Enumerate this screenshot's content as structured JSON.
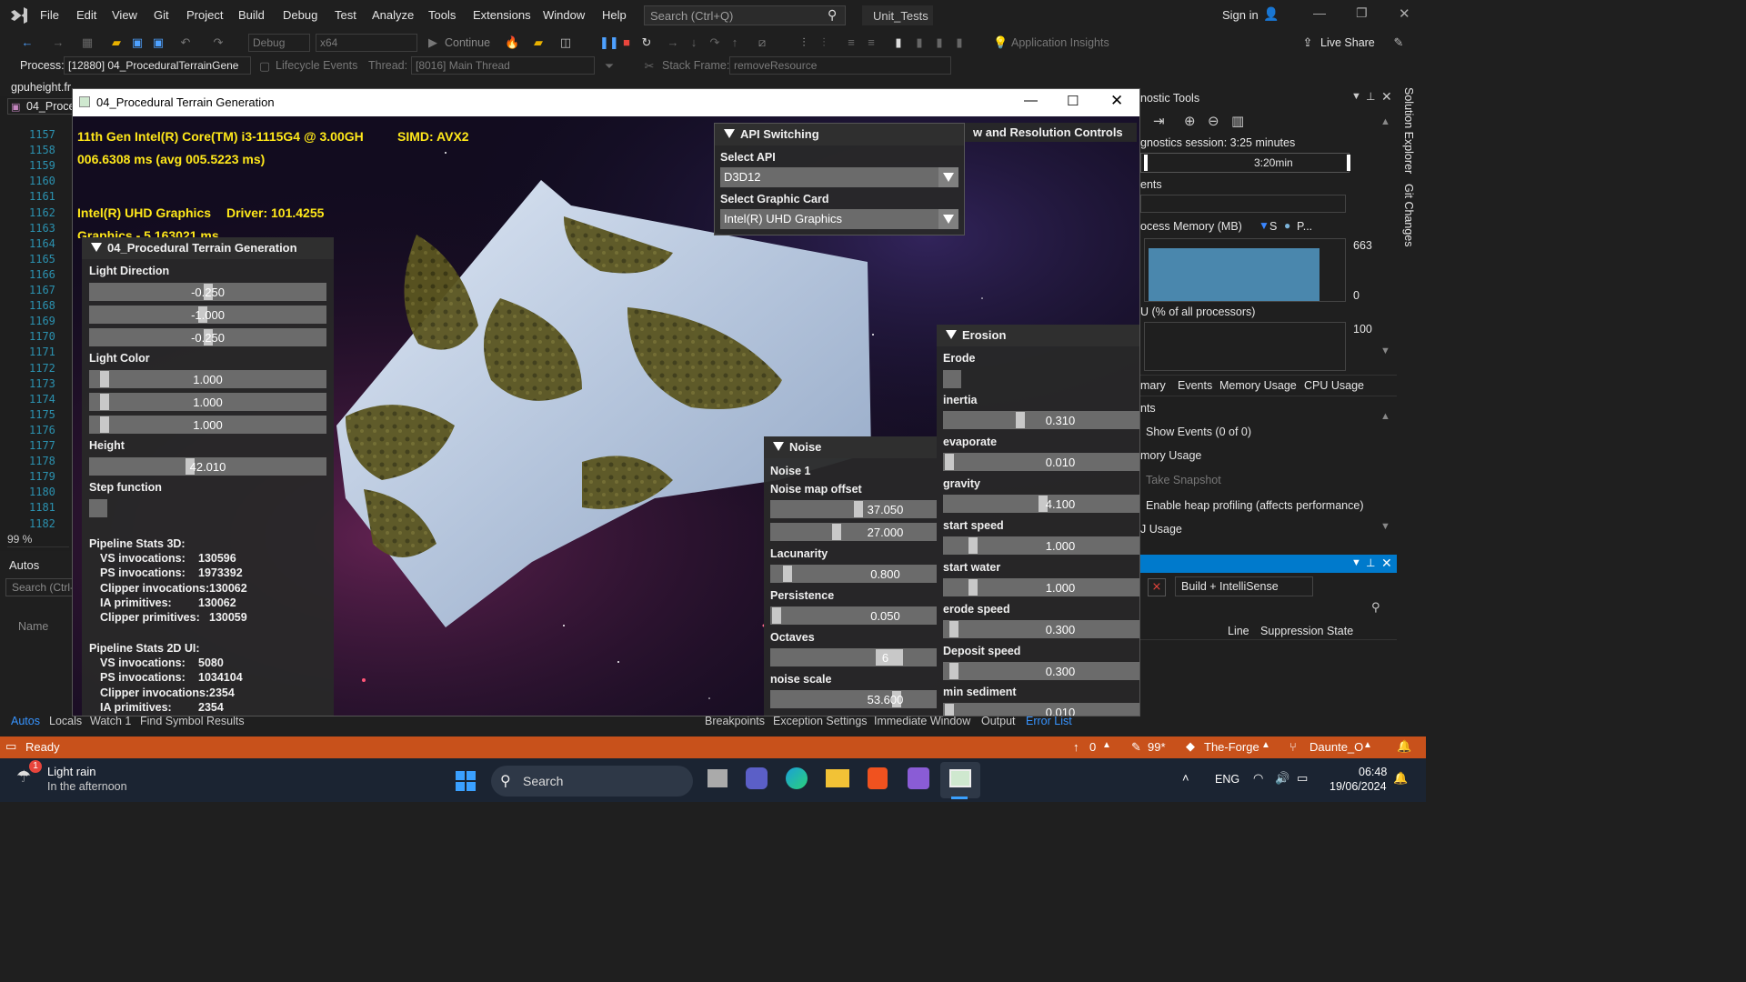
{
  "vs": {
    "menu": [
      "File",
      "Edit",
      "View",
      "Git",
      "Project",
      "Build",
      "Debug",
      "Test",
      "Analyze",
      "Tools",
      "Extensions",
      "Window",
      "Help"
    ],
    "search_placeholder": "Search (Ctrl+Q)",
    "solution_name": "Unit_Tests",
    "sign_in": "Sign in",
    "toolbar": {
      "config": "Debug",
      "platform": "x64",
      "continue": "Continue",
      "app_insights": "Application Insights",
      "live_share": "Live Share"
    },
    "debug_bar": {
      "process_label": "Process:",
      "process_value": "[12880] 04_ProceduralTerrainGene",
      "lifecycle": "Lifecycle Events",
      "thread_label": "Thread:",
      "thread_value": "[8016] Main Thread",
      "stack_label": "Stack Frame:",
      "stack_value": "removeResource"
    },
    "editor": {
      "file_tab": "gpuheight.fr",
      "nav_label": "04_Proce",
      "line_numbers": [
        "1157",
        "1158",
        "1159",
        "1160",
        "1161",
        "1162",
        "1163",
        "1164",
        "1165",
        "1166",
        "1167",
        "1168",
        "1169",
        "1170",
        "1171",
        "1172",
        "1173",
        "1174",
        "1175",
        "1176",
        "1177",
        "1178",
        "1179",
        "1180",
        "1181",
        "1182"
      ],
      "zoom": "99 %"
    },
    "autos": {
      "title": "Autos",
      "search": "Search (Ctrl-",
      "col_name": "Name"
    },
    "bottom_tabs_left": [
      "Autos",
      "Locals",
      "Watch 1",
      "Find Symbol Results"
    ],
    "bottom_tabs_right": [
      "Breakpoints",
      "Exception Settings",
      "Immediate Window",
      "Output",
      "Error List"
    ],
    "status": {
      "ready": "Ready",
      "up_count": "0",
      "edits": "99*",
      "repo": "The-Forge",
      "branch": "Daunte_O"
    },
    "diagnostics": {
      "title": "nostic Tools",
      "session": "gnostics session: 3:25 minutes",
      "time_marker": "3:20min",
      "events": "ents",
      "process_memory": "ocess Memory (MB)",
      "legend_s": "S",
      "legend_p": "P...",
      "mem_max": "663",
      "mem_min": "0",
      "cpu_title": "U (% of all processors)",
      "cpu_max": "100",
      "tabs": [
        "mary",
        "Events",
        "Memory Usage",
        "CPU Usage"
      ],
      "sections": [
        "nts",
        "Show Events (0 of 0)",
        "mory Usage",
        "Take Snapshot",
        "Enable heap profiling (affects performance)",
        "J Usage"
      ]
    },
    "errlist": {
      "filter": "Build + IntelliSense",
      "col_line": "Line",
      "col_supp": "Suppression State"
    },
    "right_strip": [
      "Solution Explorer",
      "Git Changes"
    ]
  },
  "app": {
    "title": "04_Procedural Terrain Generation",
    "hud": {
      "cpu": "11th Gen Intel(R) Core(TM) i3-1115G4 @ 3.00GH",
      "simd": "SIMD: AVX2",
      "frame_time": "006.6308 ms (avg 005.5223 ms)",
      "gpu": "Intel(R) UHD Graphics",
      "driver": "Driver: 101.4255",
      "graphics": "Graphics - 5.163021 ms"
    },
    "terrain_panel": {
      "title": "04_Procedural Terrain Generation",
      "light_direction_label": "Light Direction",
      "light_direction": [
        "-0.250",
        "-1.000",
        "-0.250"
      ],
      "light_color_label": "Light Color",
      "light_color": [
        "1.000",
        "1.000",
        "1.000"
      ],
      "height_label": "Height",
      "height": "42.010",
      "step_label": "Step function",
      "stats3d_title": "Pipeline Stats 3D:",
      "stats3d": [
        [
          "VS invocations:",
          "130596"
        ],
        [
          "PS invocations:",
          "1973392"
        ],
        [
          "Clipper invocations:",
          "130062"
        ],
        [
          "IA primitives:",
          "130062"
        ],
        [
          "Clipper primitives:",
          "130059"
        ]
      ],
      "stats2d_title": "Pipeline Stats 2D UI:",
      "stats2d": [
        [
          "VS invocations:",
          "5080"
        ],
        [
          "PS invocations:",
          "1034104"
        ],
        [
          "Clipper invocations:",
          "2354"
        ],
        [
          "IA primitives:",
          "2354"
        ]
      ]
    },
    "api_panel": {
      "title": "API Switching",
      "select_api_label": "Select API",
      "api": "D3D12",
      "select_card_label": "Select Graphic Card",
      "card": "Intel(R) UHD Graphics"
    },
    "vr_panel": {
      "title": "w and Resolution Controls"
    },
    "noise_panel": {
      "title": "Noise",
      "noise1": "Noise 1",
      "offset_label": "Noise map offset",
      "offset": [
        "37.050",
        "27.000"
      ],
      "lacunarity_label": "Lacunarity",
      "lacunarity": "0.800",
      "persistence_label": "Persistence",
      "persistence": "0.050",
      "octaves_label": "Octaves",
      "octaves": "6",
      "scale_label": "noise scale",
      "scale": "53.600"
    },
    "erosion_panel": {
      "title": "Erosion",
      "erode_label": "Erode",
      "inertia_label": "inertia",
      "inertia": "0.310",
      "evaporate_label": "evaporate",
      "evaporate": "0.010",
      "gravity_label": "gravity",
      "gravity": "4.100",
      "start_speed_label": "start speed",
      "start_speed": "1.000",
      "start_water_label": "start water",
      "start_water": "1.000",
      "erode_speed_label": "erode speed",
      "erode_speed": "0.300",
      "deposit_label": "Deposit speed",
      "deposit": "0.300",
      "min_sed_label": "min sediment",
      "min_sed": "0.010"
    }
  },
  "taskbar": {
    "weather_title": "Light rain",
    "weather_sub": "In the afternoon",
    "weather_badge": "1",
    "search": "Search",
    "lang": "ENG",
    "time": "06:48",
    "date": "19/06/2024"
  },
  "colors": {
    "accent": "#c8511b",
    "hud_yellow": "#ffe81a",
    "vs_blue": "#007acc"
  }
}
